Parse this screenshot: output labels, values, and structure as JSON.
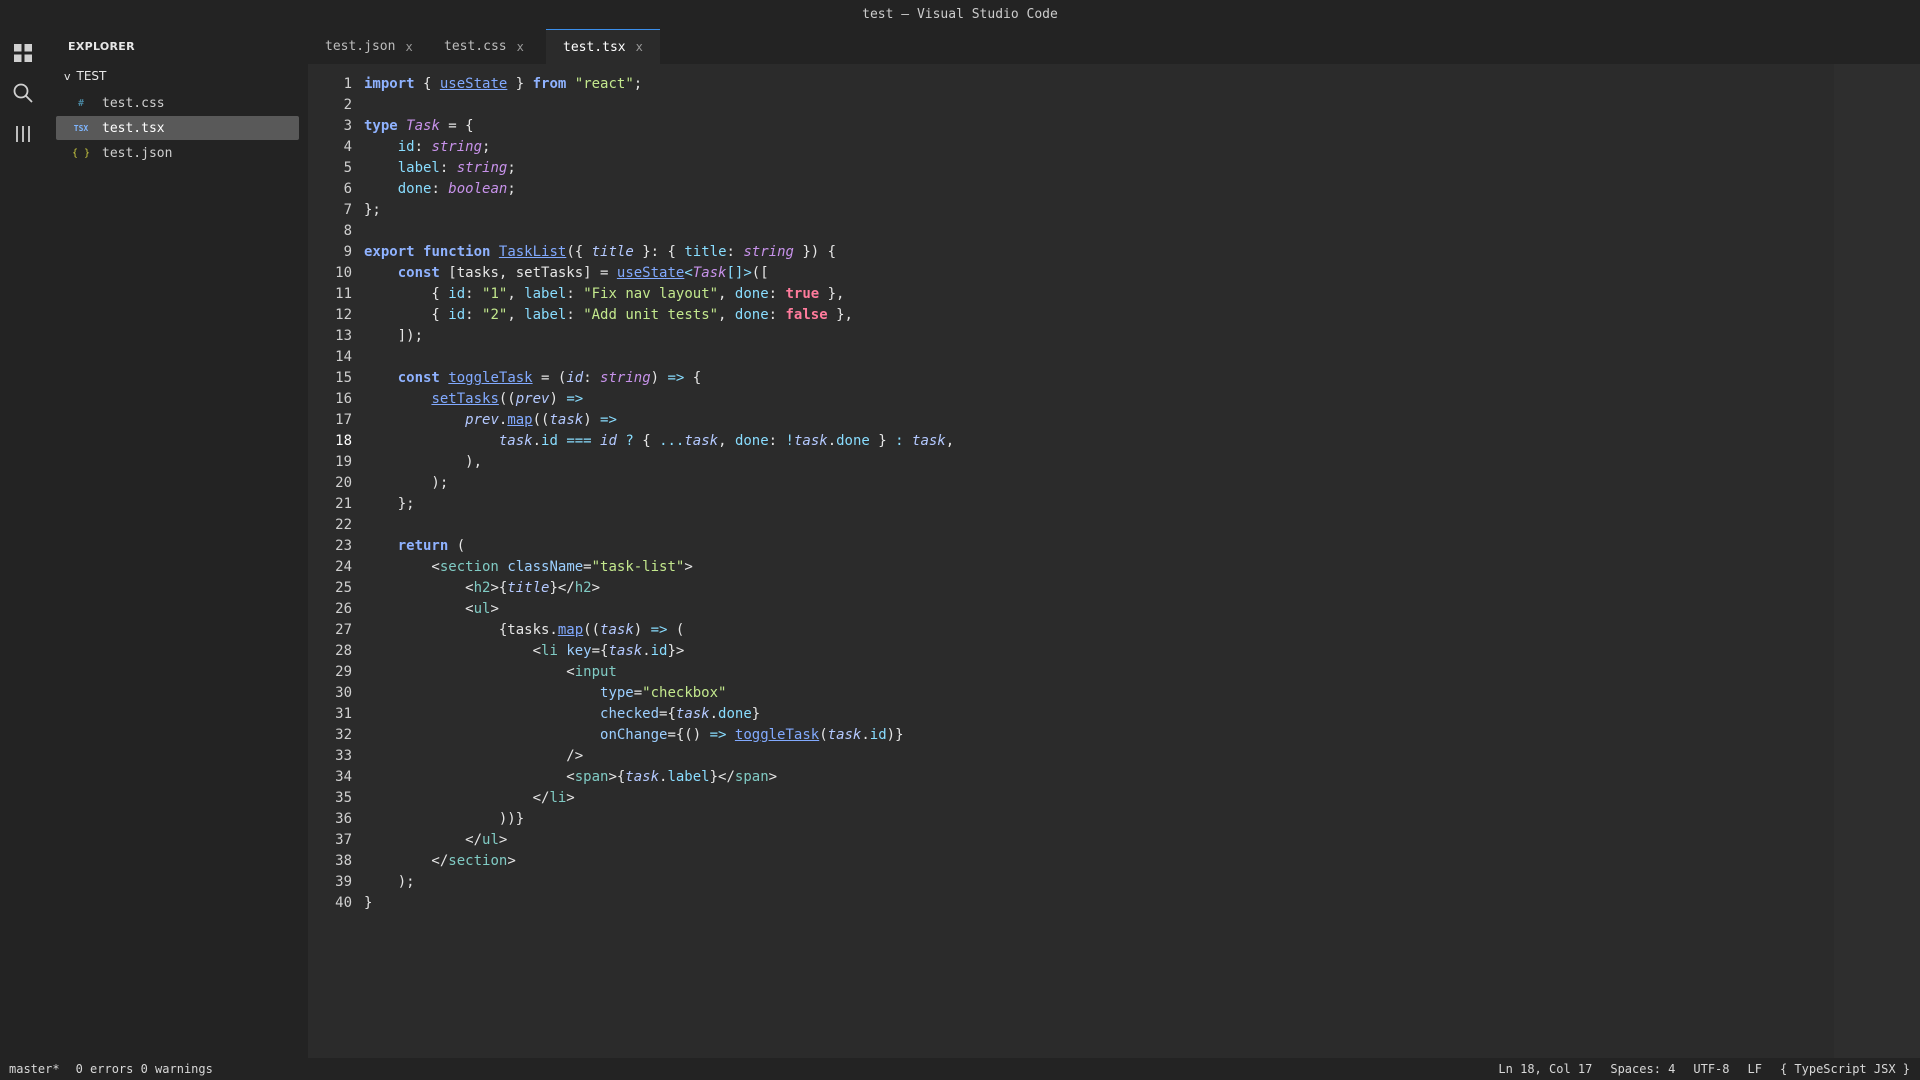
{
  "window": {
    "title": "test — Visual Studio Code"
  },
  "activity": {
    "icons": [
      "explorer-icon",
      "search-icon",
      "extensions-icon"
    ]
  },
  "sidebar": {
    "title": "EXPLORER",
    "folder": "TEST",
    "folder_chevron": "v",
    "files": [
      {
        "icon": "#",
        "label": "test.css",
        "color": "#519aba"
      },
      {
        "icon": "TSX",
        "label": "test.tsx",
        "color": "#3b8eea",
        "active": true
      },
      {
        "icon": "{ }",
        "label": "test.json",
        "color": "#cbcb41"
      }
    ]
  },
  "tabs": [
    {
      "label": "test.json",
      "close": "x"
    },
    {
      "label": "test.css",
      "close": "x"
    },
    {
      "label": "test.tsx",
      "close": "x",
      "active": true
    }
  ],
  "editor": {
    "current_line": 18,
    "lines": [
      [
        [
          "kw",
          "import"
        ],
        [
          "pl",
          " { "
        ],
        [
          "fn",
          "useState"
        ],
        [
          "pl",
          " } "
        ],
        [
          "kw",
          "from"
        ],
        [
          "pl",
          " "
        ],
        [
          "str",
          "\"react\""
        ],
        [
          "pl",
          ";"
        ]
      ],
      [],
      [
        [
          "kw",
          "type"
        ],
        [
          "pl",
          " "
        ],
        [
          "ty",
          "Task"
        ],
        [
          "pl",
          " = {"
        ]
      ],
      [
        [
          "pl",
          "    "
        ],
        [
          "prop",
          "id"
        ],
        [
          "pl",
          ": "
        ],
        [
          "ty",
          "string"
        ],
        [
          "pl",
          ";"
        ]
      ],
      [
        [
          "pl",
          "    "
        ],
        [
          "prop",
          "label"
        ],
        [
          "pl",
          ": "
        ],
        [
          "ty",
          "string"
        ],
        [
          "pl",
          ";"
        ]
      ],
      [
        [
          "pl",
          "    "
        ],
        [
          "prop",
          "done"
        ],
        [
          "pl",
          ": "
        ],
        [
          "ty",
          "boolean"
        ],
        [
          "pl",
          ";"
        ]
      ],
      [
        [
          "pl",
          "};"
        ]
      ],
      [],
      [
        [
          "kw",
          "export"
        ],
        [
          "pl",
          " "
        ],
        [
          "kw",
          "function"
        ],
        [
          "pl",
          " "
        ],
        [
          "fn",
          "TaskList"
        ],
        [
          "pl",
          "({ "
        ],
        [
          "prm",
          "title"
        ],
        [
          "pl",
          " }: { "
        ],
        [
          "prop",
          "title"
        ],
        [
          "pl",
          ": "
        ],
        [
          "ty",
          "string"
        ],
        [
          "pl",
          " }) {"
        ]
      ],
      [
        [
          "pl",
          "    "
        ],
        [
          "kw",
          "const"
        ],
        [
          "pl",
          " [tasks, setTasks] = "
        ],
        [
          "fn",
          "useState"
        ],
        [
          "op",
          "<"
        ],
        [
          "ty",
          "Task"
        ],
        [
          "op",
          "[]>"
        ],
        [
          "pl",
          "(["
        ]
      ],
      [
        [
          "pl",
          "        { "
        ],
        [
          "prop",
          "id"
        ],
        [
          "pl",
          ": "
        ],
        [
          "str",
          "\"1\""
        ],
        [
          "pl",
          ", "
        ],
        [
          "prop",
          "label"
        ],
        [
          "pl",
          ": "
        ],
        [
          "str",
          "\"Fix nav layout\""
        ],
        [
          "pl",
          ", "
        ],
        [
          "prop",
          "done"
        ],
        [
          "pl",
          ": "
        ],
        [
          "bool",
          "true"
        ],
        [
          "pl",
          " },"
        ]
      ],
      [
        [
          "pl",
          "        { "
        ],
        [
          "prop",
          "id"
        ],
        [
          "pl",
          ": "
        ],
        [
          "str",
          "\"2\""
        ],
        [
          "pl",
          ", "
        ],
        [
          "prop",
          "label"
        ],
        [
          "pl",
          ": "
        ],
        [
          "str",
          "\"Add unit tests\""
        ],
        [
          "pl",
          ", "
        ],
        [
          "prop",
          "done"
        ],
        [
          "pl",
          ": "
        ],
        [
          "bool",
          "false"
        ],
        [
          "pl",
          " },"
        ]
      ],
      [
        [
          "pl",
          "    ]);"
        ]
      ],
      [],
      [
        [
          "pl",
          "    "
        ],
        [
          "kw",
          "const"
        ],
        [
          "pl",
          " "
        ],
        [
          "fn",
          "toggleTask"
        ],
        [
          "pl",
          " = ("
        ],
        [
          "prm",
          "id"
        ],
        [
          "pl",
          ": "
        ],
        [
          "ty",
          "string"
        ],
        [
          "pl",
          ") "
        ],
        [
          "op",
          "=>"
        ],
        [
          "pl",
          " {"
        ]
      ],
      [
        [
          "pl",
          "        "
        ],
        [
          "fn",
          "setTasks"
        ],
        [
          "pl",
          "(("
        ],
        [
          "prm",
          "prev"
        ],
        [
          "pl",
          ") "
        ],
        [
          "op",
          "=>"
        ]
      ],
      [
        [
          "pl",
          "            "
        ],
        [
          "prm",
          "prev"
        ],
        [
          "pl",
          "."
        ],
        [
          "fn",
          "map"
        ],
        [
          "pl",
          "(("
        ],
        [
          "prm",
          "task"
        ],
        [
          "pl",
          ") "
        ],
        [
          "op",
          "=>"
        ]
      ],
      [
        [
          "pl",
          "                "
        ],
        [
          "prm",
          "task"
        ],
        [
          "pl",
          "."
        ],
        [
          "prop",
          "id"
        ],
        [
          "pl",
          " "
        ],
        [
          "op",
          "==="
        ],
        [
          "pl",
          " "
        ],
        [
          "prm",
          "id"
        ],
        [
          "pl",
          " "
        ],
        [
          "op",
          "?"
        ],
        [
          "pl",
          " { "
        ],
        [
          "op",
          "..."
        ],
        [
          "prm",
          "task"
        ],
        [
          "pl",
          ", "
        ],
        [
          "prop",
          "done"
        ],
        [
          "pl",
          ": "
        ],
        [
          "op",
          "!"
        ],
        [
          "prm",
          "task"
        ],
        [
          "pl",
          "."
        ],
        [
          "prop",
          "done"
        ],
        [
          "pl",
          " } "
        ],
        [
          "op",
          ":"
        ],
        [
          "pl",
          " "
        ],
        [
          "prm",
          "task"
        ],
        [
          "pl",
          ","
        ]
      ],
      [
        [
          "pl",
          "            ),"
        ]
      ],
      [
        [
          "pl",
          "        );"
        ]
      ],
      [
        [
          "pl",
          "    };"
        ]
      ],
      [],
      [
        [
          "pl",
          "    "
        ],
        [
          "kw",
          "return"
        ],
        [
          "pl",
          " ("
        ]
      ],
      [
        [
          "pl",
          "        <"
        ],
        [
          "tag",
          "section"
        ],
        [
          "pl",
          " "
        ],
        [
          "attr",
          "className"
        ],
        [
          "pl",
          "="
        ],
        [
          "str",
          "\"task-list\""
        ],
        [
          "pl",
          ">"
        ]
      ],
      [
        [
          "pl",
          "            <"
        ],
        [
          "tag",
          "h2"
        ],
        [
          "pl",
          ">{"
        ],
        [
          "prm",
          "title"
        ],
        [
          "pl",
          "}</"
        ],
        [
          "tag",
          "h2"
        ],
        [
          "pl",
          ">"
        ]
      ],
      [
        [
          "pl",
          "            <"
        ],
        [
          "tag",
          "ul"
        ],
        [
          "pl",
          ">"
        ]
      ],
      [
        [
          "pl",
          "                {tasks."
        ],
        [
          "fn",
          "map"
        ],
        [
          "pl",
          "(("
        ],
        [
          "prm",
          "task"
        ],
        [
          "pl",
          ") "
        ],
        [
          "op",
          "=>"
        ],
        [
          "pl",
          " ("
        ]
      ],
      [
        [
          "pl",
          "                    <"
        ],
        [
          "tag",
          "li"
        ],
        [
          "pl",
          " "
        ],
        [
          "attr",
          "key"
        ],
        [
          "pl",
          "={"
        ],
        [
          "prm",
          "task"
        ],
        [
          "pl",
          "."
        ],
        [
          "prop",
          "id"
        ],
        [
          "pl",
          "}>"
        ]
      ],
      [
        [
          "pl",
          "                        <"
        ],
        [
          "tag",
          "input"
        ]
      ],
      [
        [
          "pl",
          "                            "
        ],
        [
          "attr",
          "type"
        ],
        [
          "pl",
          "="
        ],
        [
          "str",
          "\"checkbox\""
        ]
      ],
      [
        [
          "pl",
          "                            "
        ],
        [
          "attr",
          "checked"
        ],
        [
          "pl",
          "={"
        ],
        [
          "prm",
          "task"
        ],
        [
          "pl",
          "."
        ],
        [
          "prop",
          "done"
        ],
        [
          "pl",
          "}"
        ]
      ],
      [
        [
          "pl",
          "                            "
        ],
        [
          "attr",
          "onChange"
        ],
        [
          "pl",
          "={() "
        ],
        [
          "op",
          "=>"
        ],
        [
          "pl",
          " "
        ],
        [
          "fn",
          "toggleTask"
        ],
        [
          "pl",
          "("
        ],
        [
          "prm",
          "task"
        ],
        [
          "pl",
          "."
        ],
        [
          "prop",
          "id"
        ],
        [
          "pl",
          ")}"
        ]
      ],
      [
        [
          "pl",
          "                        />"
        ]
      ],
      [
        [
          "pl",
          "                        <"
        ],
        [
          "tag",
          "span"
        ],
        [
          "pl",
          ">{"
        ],
        [
          "prm",
          "task"
        ],
        [
          "pl",
          "."
        ],
        [
          "prop",
          "label"
        ],
        [
          "pl",
          "}</"
        ],
        [
          "tag",
          "span"
        ],
        [
          "pl",
          ">"
        ]
      ],
      [
        [
          "pl",
          "                    </"
        ],
        [
          "tag",
          "li"
        ],
        [
          "pl",
          ">"
        ]
      ],
      [
        [
          "pl",
          "                ))}"
        ]
      ],
      [
        [
          "pl",
          "            </"
        ],
        [
          "tag",
          "ul"
        ],
        [
          "pl",
          ">"
        ]
      ],
      [
        [
          "pl",
          "        </"
        ],
        [
          "tag",
          "section"
        ],
        [
          "pl",
          ">"
        ]
      ],
      [
        [
          "pl",
          "    );"
        ]
      ],
      [
        [
          "pl",
          "}"
        ]
      ]
    ]
  },
  "status": {
    "branch": "master*",
    "problems": "0 errors 0 warnings",
    "cursor": "Ln 18, Col 17",
    "spaces": "Spaces: 4",
    "encoding": "UTF-8",
    "eol": "LF",
    "language": "{ TypeScript JSX }"
  }
}
